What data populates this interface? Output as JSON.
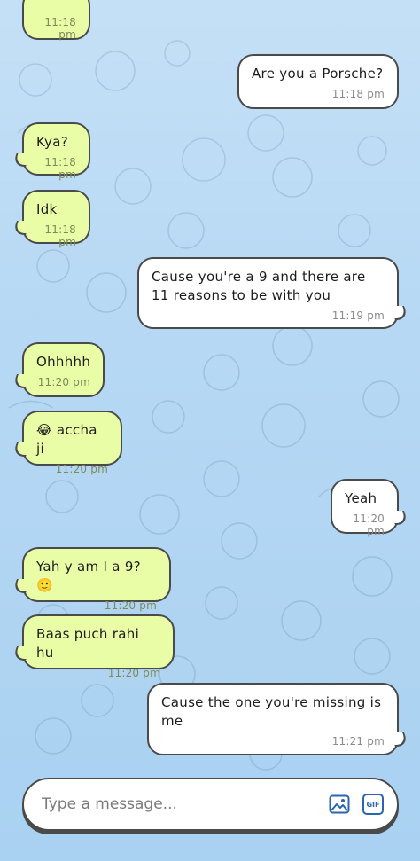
{
  "messages": [
    {
      "dir": "in",
      "text": "",
      "time": "11:18 pm"
    },
    {
      "dir": "out",
      "text": "Are you a Porsche?",
      "time": "11:18 pm"
    },
    {
      "dir": "in",
      "text": "Kya?",
      "time": "11:18 pm"
    },
    {
      "dir": "in",
      "text": "Idk",
      "time": "11:18 pm"
    },
    {
      "dir": "out",
      "text": "Cause you're a 9 and there are 11 reasons to be with you",
      "time": "11:19 pm"
    },
    {
      "dir": "in",
      "text": "Ohhhhh",
      "time": "11:20 pm"
    },
    {
      "dir": "in",
      "text": "😂 accha ji",
      "time": "11:20 pm"
    },
    {
      "dir": "out",
      "text": "Yeah",
      "time": "11:20 pm"
    },
    {
      "dir": "in",
      "text": "Yah y am I a 9? 🙂",
      "time": "11:20 pm"
    },
    {
      "dir": "in",
      "text": "Baas puch rahi hu",
      "time": "11:20 pm"
    },
    {
      "dir": "out",
      "text": "Cause the one you're missing is me",
      "time": "11:21 pm"
    }
  ],
  "composer": {
    "placeholder": "Type a message...",
    "gif_label": "GIF",
    "image_icon": "image-icon",
    "gif_icon": "gif-icon"
  },
  "colors": {
    "incoming_bubble": "#e9fca6",
    "outgoing_bubble": "#ffffff",
    "background": "#b6d8f4",
    "gif_accent": "#2a66b0"
  }
}
